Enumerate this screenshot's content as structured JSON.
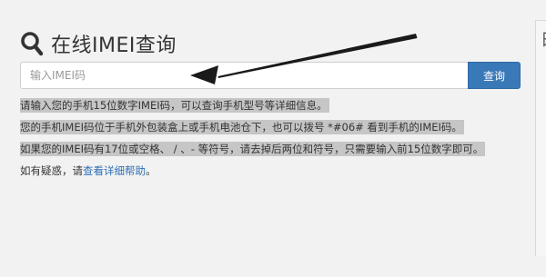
{
  "header": {
    "icon": "search-icon",
    "title": "在线IMEI查询"
  },
  "search": {
    "placeholder": "输入IMEI码",
    "value": "",
    "button_label": "查询"
  },
  "info": {
    "line1": "请输入您的手机15位数字IMEI码，可以查询手机型号等详细信息。",
    "line2": "您的手机IMEI码位于手机外包装盒上或手机电池仓下，也可以拨号 *#06# 看到手机的IMEI码。",
    "line3": "如果您的IMEI码有17位或空格、 / 、- 等符号，请去掉后两位和符号，只需要输入前15位数字即可。",
    "line4_prefix": "如有疑惑，请",
    "line4_link": "查看详细帮助",
    "line4_suffix": "。"
  },
  "side": {
    "partial_char": "日"
  },
  "colors": {
    "accent": "#3a79b8",
    "link": "#2e6fb6",
    "highlight": "#c6c6c6",
    "arrow": "#1a1a1a"
  }
}
